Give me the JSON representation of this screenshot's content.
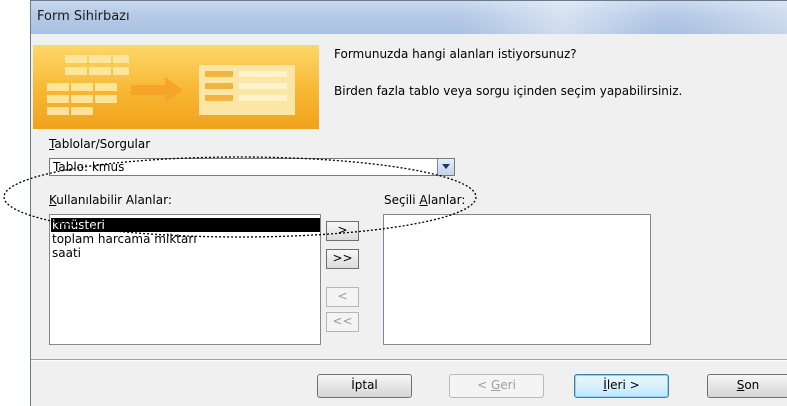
{
  "window": {
    "title": "Form Sihirbazı"
  },
  "header": {
    "question": "Formunuzda hangi alanları istiyorsunuz?",
    "hint": "Birden fazla tablo veya sorgu içinden seçim yapabilirsiniz."
  },
  "source": {
    "label_prefix": "",
    "label_accel": "T",
    "label_rest": "ablolar/Sorgular",
    "selected_value": "Tablo: kmus"
  },
  "available": {
    "label_accel": "K",
    "label_rest": "ullanılabilir Alanlar:",
    "items": [
      "kmüsteri",
      "toplam harcama miktarı",
      "saati"
    ],
    "selected_index": 0
  },
  "selected_fields": {
    "label_prefix": "Seçili ",
    "label_accel": "A",
    "label_rest": "lanlar:",
    "items": []
  },
  "move_buttons": {
    "add_one": ">",
    "add_all": ">>",
    "remove_one": "<",
    "remove_all": "<<"
  },
  "footer": {
    "cancel": "İptal",
    "back_prefix": "< ",
    "back_accel": "G",
    "back_rest": "eri",
    "next_accel": "İ",
    "next_rest": "leri >",
    "finish_accel": "S",
    "finish_rest": "on"
  },
  "colors": {
    "banner": "#f7b733",
    "titlebar": "#b7cbe7",
    "selection": "#000000"
  }
}
